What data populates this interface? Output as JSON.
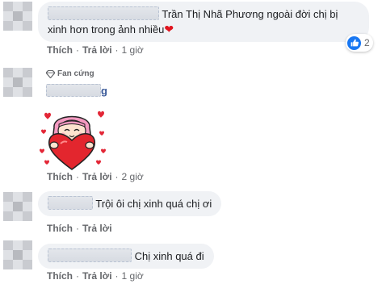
{
  "comments": [
    {
      "text": "Trần Thị Nhã Phương ngoài đời chị bị xinh hơn trong ảnh nhiều",
      "reactions": {
        "icon": "like-icon",
        "count": "2"
      },
      "actions": {
        "like": "Thích",
        "reply": "Trả lời",
        "time": "1 giờ"
      }
    },
    {
      "badge": "Fan cứng",
      "name_tail": "g",
      "sticker": "heart-hug-sticker",
      "actions": {
        "like": "Thích",
        "reply": "Trả lời",
        "time": "2 giờ"
      }
    },
    {
      "text": "Trội ôi chị xinh quá chị ơi",
      "actions": {
        "like": "Thích",
        "reply": "Trả lời",
        "time": "2 giờ"
      }
    },
    {
      "text": "Chị xinh quá đi",
      "actions": {
        "like": "Thích",
        "reply": "Trả lời",
        "time": "1 giờ"
      }
    }
  ],
  "colors": {
    "bubble": "#f0f2f5",
    "link": "#65676b",
    "like_blue": "#1877f2",
    "heart_red": "#e0141e"
  }
}
